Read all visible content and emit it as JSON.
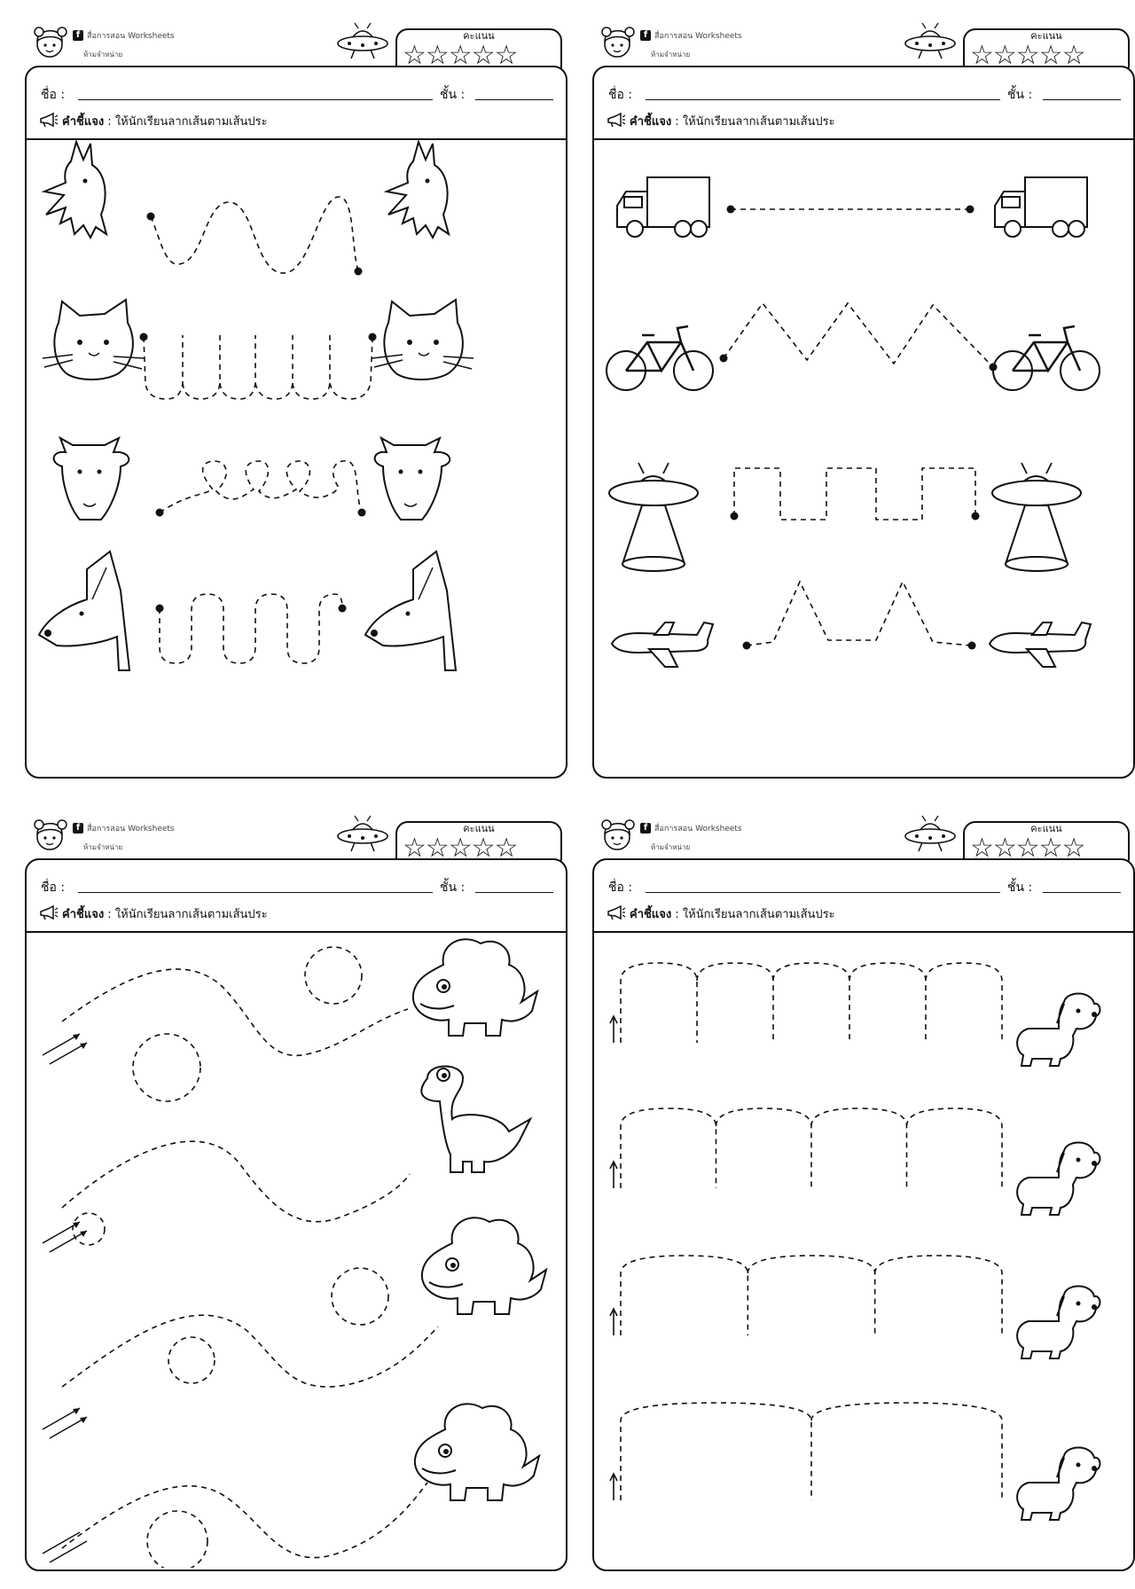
{
  "sheets": [
    {
      "brand": "สื่อการสอน  Worksheets",
      "forbid": "ห้ามจำหน่าย",
      "score_label": "คะแนน",
      "stars": "☆☆☆☆☆",
      "name_label": "ชื่อ  :",
      "grade_label": "ชั้น  :",
      "instr_title": "คำชี้แจง",
      "instr_text": " : ให้นักเรียนลากเส้นตามเส้นประ",
      "rows": [
        "chicken",
        "cat",
        "goat",
        "dog"
      ]
    },
    {
      "brand": "สื่อการสอน  Worksheets",
      "forbid": "ห้ามจำหน่าย",
      "score_label": "คะแนน",
      "stars": "☆☆☆☆☆",
      "name_label": "ชื่อ  :",
      "grade_label": "ชั้น  :",
      "instr_title": "คำชี้แจง",
      "instr_text": " : ให้นักเรียนลากเส้นตามเส้นประ",
      "rows": [
        "truck",
        "bicycle",
        "ufo",
        "airplane"
      ]
    },
    {
      "brand": "สื่อการสอน  Worksheets",
      "forbid": "ห้ามจำหน่าย",
      "score_label": "คะแนน",
      "stars": "☆☆☆☆☆",
      "name_label": "ชื่อ  :",
      "grade_label": "ชั้น  :",
      "instr_title": "คำชี้แจง",
      "instr_text": " : ให้นักเรียนลากเส้นตามเส้นประ",
      "rows": [
        "stegosaurus",
        "brachiosaurus",
        "triceratops",
        "dinosaur"
      ]
    },
    {
      "brand": "สื่อการสอน  Worksheets",
      "forbid": "ห้ามจำหน่าย",
      "score_label": "คะแนน",
      "stars": "☆☆☆☆☆",
      "name_label": "ชื่อ  :",
      "grade_label": "ชั้น  :",
      "instr_title": "คำชี้แจง",
      "instr_text": " : ให้นักเรียนลากเส้นตามเส้นประ",
      "rows": [
        "dog",
        "dog",
        "dog",
        "dog"
      ]
    }
  ],
  "colors": {
    "ink": "#111111",
    "paper": "#ffffff"
  }
}
